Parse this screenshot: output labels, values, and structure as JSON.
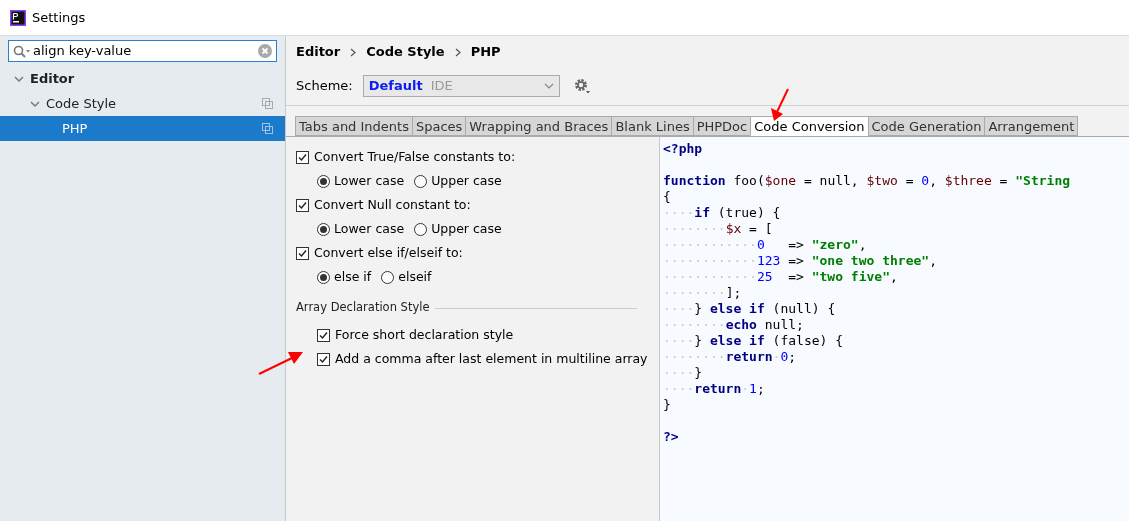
{
  "window": {
    "title": "Settings"
  },
  "search": {
    "value": "align key-value"
  },
  "sidebar": {
    "items": [
      {
        "label": "Editor",
        "expanded": true,
        "selected": false,
        "children": [
          {
            "label": "Code Style",
            "expanded": true,
            "selected": false,
            "children": [
              {
                "label": "PHP",
                "selected": true
              }
            ]
          }
        ]
      }
    ]
  },
  "breadcrumb": [
    "Editor",
    "Code Style",
    "PHP"
  ],
  "scheme": {
    "label": "Scheme:",
    "name": "Default",
    "scope": "IDE"
  },
  "tabs": [
    {
      "label": "Tabs and Indents",
      "selected": false
    },
    {
      "label": "Spaces",
      "selected": false
    },
    {
      "label": "Wrapping and Braces",
      "selected": false
    },
    {
      "label": "Blank Lines",
      "selected": false
    },
    {
      "label": "PHPDoc",
      "selected": false
    },
    {
      "label": "Code Conversion",
      "selected": true
    },
    {
      "label": "Code Generation",
      "selected": false
    },
    {
      "label": "Arrangement",
      "selected": false
    }
  ],
  "options": [
    {
      "label": "Convert True/False constants to:",
      "checked": true,
      "radios": [
        {
          "label": "Lower case",
          "selected": true
        },
        {
          "label": "Upper case",
          "selected": false
        }
      ]
    },
    {
      "label": "Convert Null constant to:",
      "checked": true,
      "radios": [
        {
          "label": "Lower case",
          "selected": true
        },
        {
          "label": "Upper case",
          "selected": false
        }
      ]
    },
    {
      "label": "Convert else if/elseif to:",
      "checked": true,
      "radios": [
        {
          "label": "else if",
          "selected": true
        },
        {
          "label": "elseif",
          "selected": false
        }
      ]
    }
  ],
  "array_section": {
    "title": "Array Declaration Style",
    "options": [
      {
        "label": "Force short declaration style",
        "checked": true
      },
      {
        "label": "Add a comma after last element in multiline array",
        "checked": true
      }
    ]
  },
  "code_preview": [
    {
      "gap_before": false,
      "tokens": [
        {
          "kind": "tag",
          "text": "<?php"
        }
      ]
    },
    {
      "gap_before": true,
      "tokens": [
        {
          "kind": "keyword",
          "text": "function"
        },
        {
          "kind": "plain",
          "text": " foo("
        },
        {
          "kind": "var",
          "text": "$one"
        },
        {
          "kind": "plain",
          "text": " = null, "
        },
        {
          "kind": "var",
          "text": "$two"
        },
        {
          "kind": "plain",
          "text": " = "
        },
        {
          "kind": "number",
          "text": "0"
        },
        {
          "kind": "plain",
          "text": ", "
        },
        {
          "kind": "var",
          "text": "$three"
        },
        {
          "kind": "plain",
          "text": " = "
        },
        {
          "kind": "string",
          "text": "\"String"
        }
      ]
    },
    {
      "gap_before": false,
      "tokens": [
        {
          "kind": "plain",
          "text": "{"
        }
      ]
    },
    {
      "gap_before": false,
      "tokens": [
        {
          "kind": "ws",
          "text": "····"
        },
        {
          "kind": "keyword",
          "text": "if"
        },
        {
          "kind": "plain",
          "text": " (true) {"
        }
      ]
    },
    {
      "gap_before": false,
      "tokens": [
        {
          "kind": "ws",
          "text": "········"
        },
        {
          "kind": "var",
          "text": "$x"
        },
        {
          "kind": "plain",
          "text": " = ["
        }
      ]
    },
    {
      "gap_before": false,
      "tokens": [
        {
          "kind": "ws",
          "text": "············"
        },
        {
          "kind": "number",
          "text": "0"
        },
        {
          "kind": "plain",
          "text": "   => "
        },
        {
          "kind": "string",
          "text": "\"zero\""
        },
        {
          "kind": "plain",
          "text": ","
        }
      ]
    },
    {
      "gap_before": false,
      "tokens": [
        {
          "kind": "ws",
          "text": "············"
        },
        {
          "kind": "number",
          "text": "123"
        },
        {
          "kind": "plain",
          "text": " => "
        },
        {
          "kind": "string",
          "text": "\"one two three\""
        },
        {
          "kind": "plain",
          "text": ","
        }
      ]
    },
    {
      "gap_before": false,
      "tokens": [
        {
          "kind": "ws",
          "text": "············"
        },
        {
          "kind": "number",
          "text": "25"
        },
        {
          "kind": "plain",
          "text": "  => "
        },
        {
          "kind": "string",
          "text": "\"two five\""
        },
        {
          "kind": "plain",
          "text": ","
        }
      ]
    },
    {
      "gap_before": false,
      "tokens": [
        {
          "kind": "ws",
          "text": "········"
        },
        {
          "kind": "plain",
          "text": "];"
        }
      ]
    },
    {
      "gap_before": false,
      "tokens": [
        {
          "kind": "ws",
          "text": "····"
        },
        {
          "kind": "plain",
          "text": "} "
        },
        {
          "kind": "keyword",
          "text": "else if"
        },
        {
          "kind": "plain",
          "text": " (null) {"
        }
      ]
    },
    {
      "gap_before": false,
      "tokens": [
        {
          "kind": "ws",
          "text": "········"
        },
        {
          "kind": "keyword",
          "text": "echo"
        },
        {
          "kind": "plain",
          "text": " null;"
        }
      ]
    },
    {
      "gap_before": false,
      "tokens": [
        {
          "kind": "ws",
          "text": "····"
        },
        {
          "kind": "plain",
          "text": "} "
        },
        {
          "kind": "keyword",
          "text": "else if"
        },
        {
          "kind": "plain",
          "text": " (false) {"
        }
      ]
    },
    {
      "gap_before": false,
      "tokens": [
        {
          "kind": "ws",
          "text": "········"
        },
        {
          "kind": "keyword",
          "text": "return"
        },
        {
          "kind": "ws",
          "text": "·"
        },
        {
          "kind": "number",
          "text": "0"
        },
        {
          "kind": "plain",
          "text": ";"
        }
      ]
    },
    {
      "gap_before": false,
      "tokens": [
        {
          "kind": "ws",
          "text": "····"
        },
        {
          "kind": "plain",
          "text": "}"
        }
      ]
    },
    {
      "gap_before": false,
      "tokens": [
        {
          "kind": "ws",
          "text": "····"
        },
        {
          "kind": "keyword",
          "text": "return"
        },
        {
          "kind": "ws",
          "text": "·"
        },
        {
          "kind": "number",
          "text": "1"
        },
        {
          "kind": "plain",
          "text": ";"
        }
      ]
    },
    {
      "gap_before": false,
      "tokens": [
        {
          "kind": "plain",
          "text": "}"
        }
      ]
    },
    {
      "gap_before": true,
      "tokens": [
        {
          "kind": "tag",
          "text": "?>"
        }
      ]
    }
  ]
}
